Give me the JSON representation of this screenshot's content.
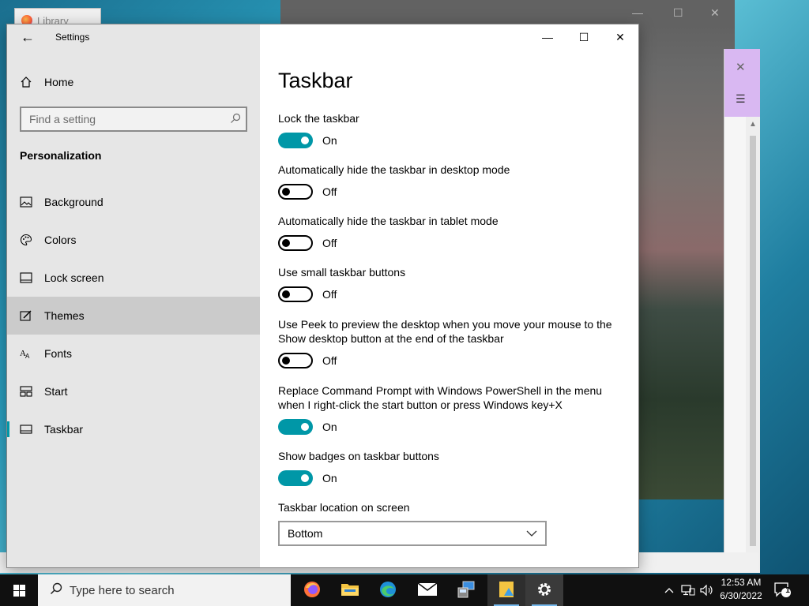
{
  "background_windows": {
    "library_title": "Library"
  },
  "window": {
    "app_title": "Settings",
    "back_label": "←",
    "minimize": "—",
    "maximize": "☐",
    "close": "✕"
  },
  "sidebar": {
    "home_label": "Home",
    "search_placeholder": "Find a setting",
    "section_title": "Personalization",
    "items": [
      {
        "label": "Background",
        "icon": "picture-icon"
      },
      {
        "label": "Colors",
        "icon": "palette-icon"
      },
      {
        "label": "Lock screen",
        "icon": "lock-screen-icon"
      },
      {
        "label": "Themes",
        "icon": "themes-icon"
      },
      {
        "label": "Fonts",
        "icon": "fonts-icon"
      },
      {
        "label": "Start",
        "icon": "start-icon"
      },
      {
        "label": "Taskbar",
        "icon": "taskbar-icon"
      }
    ],
    "hovered": "Themes",
    "selected": "Taskbar",
    "accent_color": "#0097a7"
  },
  "main": {
    "page_title": "Taskbar",
    "settings": [
      {
        "label": "Lock the taskbar",
        "state": "On",
        "on": true
      },
      {
        "label": "Automatically hide the taskbar in desktop mode",
        "state": "Off",
        "on": false
      },
      {
        "label": "Automatically hide the taskbar in tablet mode",
        "state": "Off",
        "on": false
      },
      {
        "label": "Use small taskbar buttons",
        "state": "Off",
        "on": false
      },
      {
        "label": "Use Peek to preview the desktop when you move your mouse to the Show desktop button at the end of the taskbar",
        "state": "Off",
        "on": false
      },
      {
        "label": "Replace Command Prompt with Windows PowerShell in the menu when I right-click the start button or press Windows key+X",
        "state": "On",
        "on": true
      },
      {
        "label": "Show badges on taskbar buttons",
        "state": "On",
        "on": true
      }
    ],
    "location_label": "Taskbar location on screen",
    "location_value": "Bottom"
  },
  "taskbar": {
    "search_placeholder": "Type here to search",
    "apps": [
      "firefox-icon",
      "file-explorer-icon",
      "edge-icon",
      "mail-icon",
      "network-app-icon",
      "photos-icon",
      "settings-icon"
    ],
    "time": "12:53 AM",
    "date": "6/30/2022",
    "notification_count": "1"
  }
}
